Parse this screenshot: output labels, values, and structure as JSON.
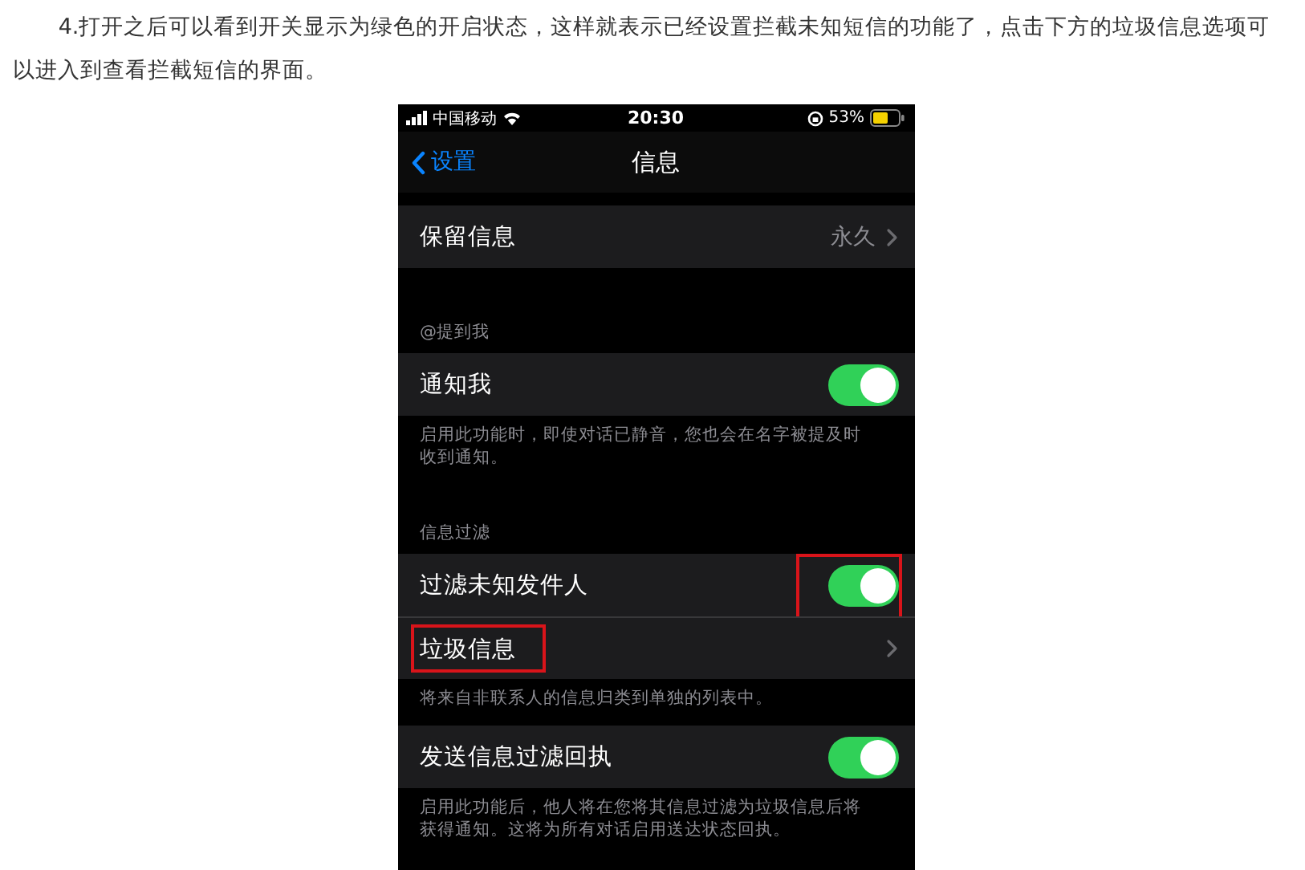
{
  "article": {
    "paragraph": "4.打开之后可以看到开关显示为绿色的开启状态，这样就表示已经设置拦截未知短信的功能了，点击下方的垃圾信息选项可以进入到查看拦截短信的界面。"
  },
  "phone": {
    "status_bar": {
      "carrier": "中国移动",
      "time": "20:30",
      "battery": "53%"
    },
    "nav": {
      "back": "设置",
      "title": "信息"
    },
    "sections": [
      {
        "rows": [
          {
            "kind": "value",
            "label": "保留信息",
            "value": "永久",
            "outlined": false
          }
        ]
      },
      {
        "header": "@提到我",
        "rows": [
          {
            "kind": "toggle",
            "label": "通知我",
            "on": true,
            "outlined": false
          }
        ],
        "footer": "启用此功能时，即使对话已静音，您也会在名字被提及时收到通知。"
      },
      {
        "header": "信息过滤",
        "rows": [
          {
            "kind": "toggle",
            "label": "过滤未知发件人",
            "on": true,
            "outlined": true
          },
          {
            "kind": "link",
            "label": "垃圾信息",
            "outlined": true
          }
        ],
        "footer": "将来自非联系人的信息归类到单独的列表中。"
      },
      {
        "rows": [
          {
            "kind": "toggle",
            "label": "发送信息过滤回执",
            "on": true,
            "outlined": false
          }
        ],
        "footer": "启用此功能后，他人将在您将其信息过滤为垃圾信息后将获得通知。这将为所有对话启用送达状态回执。"
      }
    ]
  }
}
